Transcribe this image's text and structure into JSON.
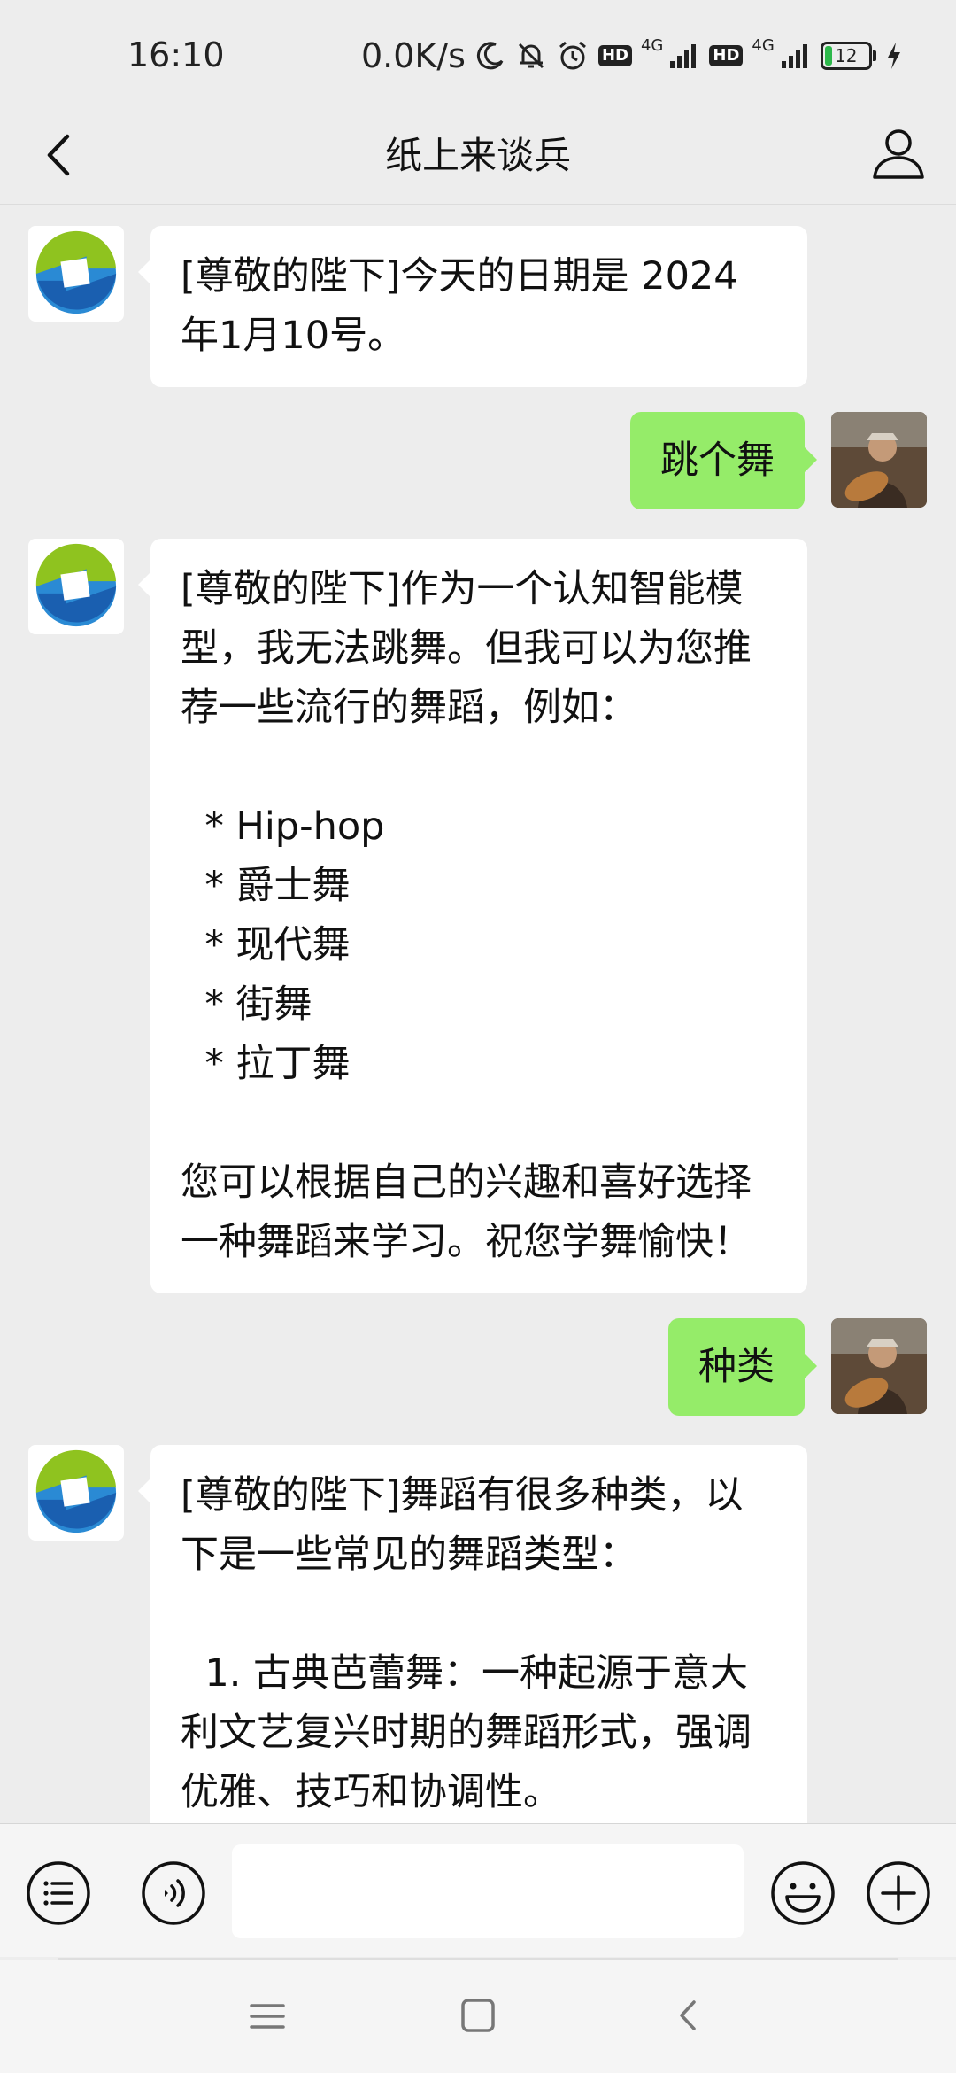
{
  "status_bar": {
    "time": "16:10",
    "net_speed": "0.0K/s",
    "hd_badge_1": "HD",
    "hd_badge_2": "HD",
    "network_1": "4G",
    "network_2": "4G",
    "battery_level": "12",
    "icons": [
      "moon-icon",
      "mute-bell-icon",
      "alarm-icon",
      "signal-icon",
      "battery-icon",
      "charging-icon"
    ]
  },
  "header": {
    "title": "纸上来谈兵",
    "back_icon": "chevron-left-icon",
    "profile_icon": "person-icon"
  },
  "messages": [
    {
      "sender": "bot",
      "text": "[尊敬的陛下]今天的日期是 2024\n年1月10号。"
    },
    {
      "sender": "user",
      "text": "跳个舞"
    },
    {
      "sender": "bot",
      "text": "[尊敬的陛下]作为一个认知智能模\n型，我无法跳舞。但我可以为您推\n荐一些流行的舞蹈，例如：\n\n  * Hip-hop\n  * 爵士舞\n  * 现代舞\n  * 街舞\n  * 拉丁舞\n\n您可以根据自己的兴趣和喜好选择\n一种舞蹈来学习。祝您学舞愉快！"
    },
    {
      "sender": "user",
      "text": "种类"
    },
    {
      "sender": "bot",
      "text": "[尊敬的陛下]舞蹈有很多种类，以\n下是一些常见的舞蹈类型：\n\n  1. 古典芭蕾舞：一种起源于意大\n利文艺复兴时期的舞蹈形式，强调\n优雅、技巧和协调性。"
    }
  ],
  "input_bar": {
    "input_value": "",
    "icons": [
      "menu-list-icon",
      "voice-icon",
      "emoji-icon",
      "plus-icon"
    ]
  },
  "system_nav": {
    "icons": [
      "recents-icon",
      "home-icon",
      "back-icon"
    ]
  },
  "colors": {
    "background": "#ededed",
    "user_bubble": "#95ec69",
    "bot_bubble": "#ffffff"
  }
}
